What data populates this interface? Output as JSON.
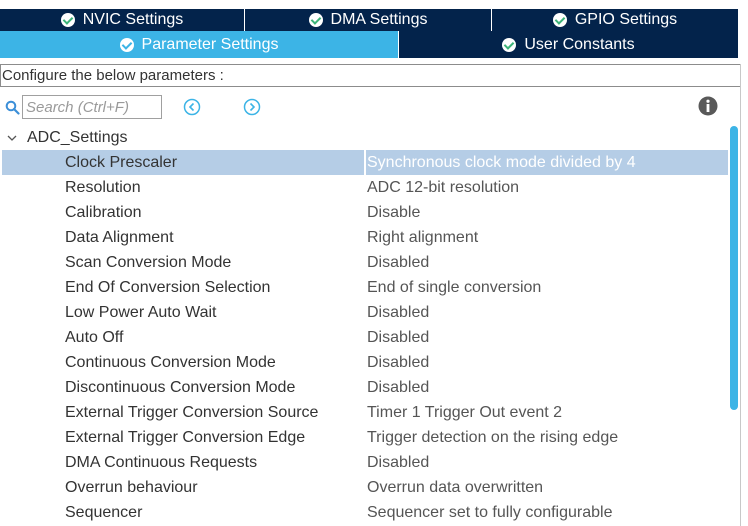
{
  "tabs": {
    "row1": [
      {
        "label": "NVIC Settings",
        "status": "ok"
      },
      {
        "label": "DMA Settings",
        "status": "ok"
      },
      {
        "label": "GPIO Settings",
        "status": "ok"
      }
    ],
    "row2": [
      {
        "label": "Parameter Settings",
        "status": "ok",
        "active": true
      },
      {
        "label": "User Constants",
        "status": "ok"
      }
    ]
  },
  "configure_label": "Configure the below parameters :",
  "search": {
    "placeholder": "Search (Ctrl+F)",
    "value": ""
  },
  "icons": {
    "search": "search-icon",
    "prev": "arrow-left-circle-icon",
    "next": "arrow-right-circle-icon",
    "info": "info-icon",
    "expand": "chevron-down-icon"
  },
  "colors": {
    "tab_dark": "#03234b",
    "tab_active": "#3cb4e6",
    "selected_row": "#b5cde6",
    "scrollbar": "#3cb4e6",
    "check_ok": "#3cb479"
  },
  "group": {
    "label": "ADC_Settings",
    "expanded": true
  },
  "parameters": [
    {
      "name": "Clock Prescaler",
      "value": "Synchronous clock mode divided by 4",
      "selected": true
    },
    {
      "name": "Resolution",
      "value": "ADC 12-bit resolution"
    },
    {
      "name": "Calibration",
      "value": "Disable"
    },
    {
      "name": "Data Alignment",
      "value": "Right alignment"
    },
    {
      "name": "Scan Conversion Mode",
      "value": "Disabled"
    },
    {
      "name": "End Of Conversion Selection",
      "value": "End of single conversion"
    },
    {
      "name": "Low Power Auto Wait",
      "value": "Disabled"
    },
    {
      "name": "Auto Off",
      "value": "Disabled"
    },
    {
      "name": "Continuous Conversion Mode",
      "value": "Disabled"
    },
    {
      "name": "Discontinuous Conversion Mode",
      "value": "Disabled"
    },
    {
      "name": "External Trigger Conversion Source",
      "value": "Timer 1 Trigger Out event 2"
    },
    {
      "name": "External Trigger Conversion Edge",
      "value": "Trigger detection on the rising edge"
    },
    {
      "name": "DMA Continuous Requests",
      "value": "Disabled"
    },
    {
      "name": "Overrun behaviour",
      "value": "Overrun data overwritten"
    },
    {
      "name": "Sequencer",
      "value": "Sequencer set to fully configurable"
    }
  ]
}
